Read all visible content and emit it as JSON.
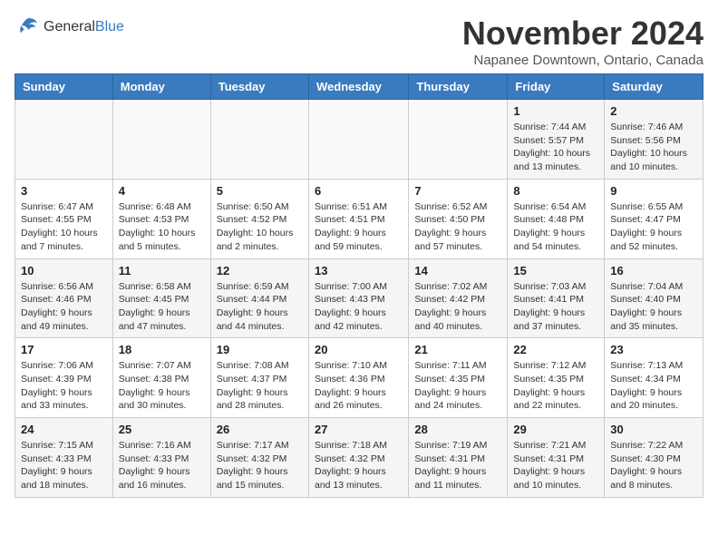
{
  "header": {
    "logo_general": "General",
    "logo_blue": "Blue",
    "month_title": "November 2024",
    "subtitle": "Napanee Downtown, Ontario, Canada"
  },
  "weekdays": [
    "Sunday",
    "Monday",
    "Tuesday",
    "Wednesday",
    "Thursday",
    "Friday",
    "Saturday"
  ],
  "weeks": [
    [
      {
        "day": "",
        "info": ""
      },
      {
        "day": "",
        "info": ""
      },
      {
        "day": "",
        "info": ""
      },
      {
        "day": "",
        "info": ""
      },
      {
        "day": "",
        "info": ""
      },
      {
        "day": "1",
        "info": "Sunrise: 7:44 AM\nSunset: 5:57 PM\nDaylight: 10 hours and 13 minutes."
      },
      {
        "day": "2",
        "info": "Sunrise: 7:46 AM\nSunset: 5:56 PM\nDaylight: 10 hours and 10 minutes."
      }
    ],
    [
      {
        "day": "3",
        "info": "Sunrise: 6:47 AM\nSunset: 4:55 PM\nDaylight: 10 hours and 7 minutes."
      },
      {
        "day": "4",
        "info": "Sunrise: 6:48 AM\nSunset: 4:53 PM\nDaylight: 10 hours and 5 minutes."
      },
      {
        "day": "5",
        "info": "Sunrise: 6:50 AM\nSunset: 4:52 PM\nDaylight: 10 hours and 2 minutes."
      },
      {
        "day": "6",
        "info": "Sunrise: 6:51 AM\nSunset: 4:51 PM\nDaylight: 9 hours and 59 minutes."
      },
      {
        "day": "7",
        "info": "Sunrise: 6:52 AM\nSunset: 4:50 PM\nDaylight: 9 hours and 57 minutes."
      },
      {
        "day": "8",
        "info": "Sunrise: 6:54 AM\nSunset: 4:48 PM\nDaylight: 9 hours and 54 minutes."
      },
      {
        "day": "9",
        "info": "Sunrise: 6:55 AM\nSunset: 4:47 PM\nDaylight: 9 hours and 52 minutes."
      }
    ],
    [
      {
        "day": "10",
        "info": "Sunrise: 6:56 AM\nSunset: 4:46 PM\nDaylight: 9 hours and 49 minutes."
      },
      {
        "day": "11",
        "info": "Sunrise: 6:58 AM\nSunset: 4:45 PM\nDaylight: 9 hours and 47 minutes."
      },
      {
        "day": "12",
        "info": "Sunrise: 6:59 AM\nSunset: 4:44 PM\nDaylight: 9 hours and 44 minutes."
      },
      {
        "day": "13",
        "info": "Sunrise: 7:00 AM\nSunset: 4:43 PM\nDaylight: 9 hours and 42 minutes."
      },
      {
        "day": "14",
        "info": "Sunrise: 7:02 AM\nSunset: 4:42 PM\nDaylight: 9 hours and 40 minutes."
      },
      {
        "day": "15",
        "info": "Sunrise: 7:03 AM\nSunset: 4:41 PM\nDaylight: 9 hours and 37 minutes."
      },
      {
        "day": "16",
        "info": "Sunrise: 7:04 AM\nSunset: 4:40 PM\nDaylight: 9 hours and 35 minutes."
      }
    ],
    [
      {
        "day": "17",
        "info": "Sunrise: 7:06 AM\nSunset: 4:39 PM\nDaylight: 9 hours and 33 minutes."
      },
      {
        "day": "18",
        "info": "Sunrise: 7:07 AM\nSunset: 4:38 PM\nDaylight: 9 hours and 30 minutes."
      },
      {
        "day": "19",
        "info": "Sunrise: 7:08 AM\nSunset: 4:37 PM\nDaylight: 9 hours and 28 minutes."
      },
      {
        "day": "20",
        "info": "Sunrise: 7:10 AM\nSunset: 4:36 PM\nDaylight: 9 hours and 26 minutes."
      },
      {
        "day": "21",
        "info": "Sunrise: 7:11 AM\nSunset: 4:35 PM\nDaylight: 9 hours and 24 minutes."
      },
      {
        "day": "22",
        "info": "Sunrise: 7:12 AM\nSunset: 4:35 PM\nDaylight: 9 hours and 22 minutes."
      },
      {
        "day": "23",
        "info": "Sunrise: 7:13 AM\nSunset: 4:34 PM\nDaylight: 9 hours and 20 minutes."
      }
    ],
    [
      {
        "day": "24",
        "info": "Sunrise: 7:15 AM\nSunset: 4:33 PM\nDaylight: 9 hours and 18 minutes."
      },
      {
        "day": "25",
        "info": "Sunrise: 7:16 AM\nSunset: 4:33 PM\nDaylight: 9 hours and 16 minutes."
      },
      {
        "day": "26",
        "info": "Sunrise: 7:17 AM\nSunset: 4:32 PM\nDaylight: 9 hours and 15 minutes."
      },
      {
        "day": "27",
        "info": "Sunrise: 7:18 AM\nSunset: 4:32 PM\nDaylight: 9 hours and 13 minutes."
      },
      {
        "day": "28",
        "info": "Sunrise: 7:19 AM\nSunset: 4:31 PM\nDaylight: 9 hours and 11 minutes."
      },
      {
        "day": "29",
        "info": "Sunrise: 7:21 AM\nSunset: 4:31 PM\nDaylight: 9 hours and 10 minutes."
      },
      {
        "day": "30",
        "info": "Sunrise: 7:22 AM\nSunset: 4:30 PM\nDaylight: 9 hours and 8 minutes."
      }
    ]
  ]
}
